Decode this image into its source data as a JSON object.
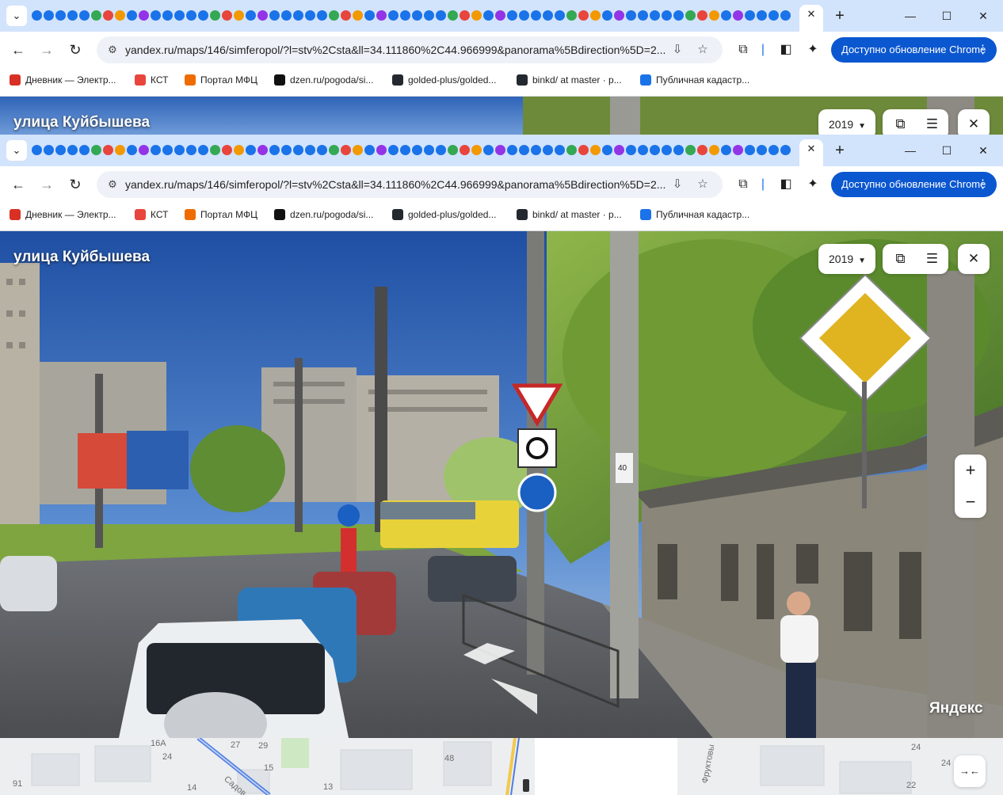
{
  "browser": {
    "url": "yandex.ru/maps/146/simferopol/?l=stv%2Csta&ll=34.111860%2C44.966999&panorama%5Bdirection%5D=2...",
    "update_label": "Доступно обновление Chrome",
    "bookmarks": [
      {
        "label": "Дневник — Электр...",
        "icon": "ladybug-icon",
        "color": "#d93025"
      },
      {
        "label": "КСТ",
        "icon": "kst-logo-icon",
        "color": "#e8453c"
      },
      {
        "label": "Портал МФЦ",
        "icon": "mfc-logo-icon",
        "color": "#ef6c00"
      },
      {
        "label": "dzen.ru/pogoda/si...",
        "icon": "dzen-icon",
        "color": "#111111"
      },
      {
        "label": "golded-plus/golded...",
        "icon": "github-icon",
        "color": "#24292f"
      },
      {
        "label": "binkd/ at master · p...",
        "icon": "github-icon",
        "color": "#24292f"
      },
      {
        "label": "Публичная кадастр...",
        "icon": "cadastre-icon",
        "color": "#1a73e8"
      }
    ]
  },
  "panorama": {
    "street_name": "улица Куйбышева",
    "year": "2019",
    "watermark": "Яндекс",
    "sign_text": "40"
  },
  "map": {
    "labels": [
      "16А",
      "24",
      "27",
      "29",
      "15",
      "48",
      "14",
      "13",
      "91",
      "24",
      "24",
      "22"
    ],
    "street_labels": [
      "Садов",
      "Фруктовы"
    ]
  },
  "colors": {
    "tabstrip": "#d2e3fc",
    "accent": "#0b57d0"
  }
}
